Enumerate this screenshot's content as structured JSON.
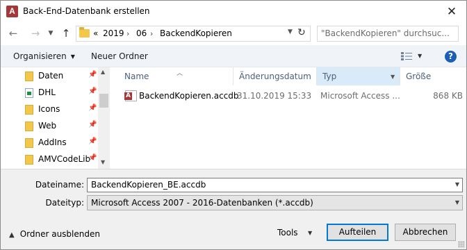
{
  "window": {
    "title": "Back-End-Datenbank erstellen",
    "app_icon_letter": "A",
    "close_glyph": "✕"
  },
  "navigation": {
    "back_glyph": "←",
    "forward_glyph": "→",
    "dropdown_glyph": "⌄",
    "up_glyph": "↑",
    "breadcrumb_overflow": "«",
    "breadcrumb": [
      "2019",
      "06",
      "BackendKopieren"
    ],
    "separator": "›",
    "refresh_glyph": "↻",
    "search_placeholder": "\"BackendKopieren\" durchsuc..."
  },
  "toolbar": {
    "organize_label": "Organisieren",
    "new_folder_label": "Neuer Ordner",
    "help_glyph": "?"
  },
  "sidebar": {
    "items": [
      {
        "label": "Daten",
        "icon": "folder-icon"
      },
      {
        "label": "DHL",
        "icon": "document-icon"
      },
      {
        "label": "Icons",
        "icon": "folder-icon"
      },
      {
        "label": "Web",
        "icon": "folder-icon"
      },
      {
        "label": "AddIns",
        "icon": "folder-icon"
      },
      {
        "label": "AMVCodeLib",
        "icon": "folder-icon"
      }
    ],
    "pin_glyph": "📌"
  },
  "filelist": {
    "columns": {
      "name": "Name",
      "date": "Änderungsdatum",
      "type": "Typ",
      "size": "Größe"
    },
    "rows": [
      {
        "name": "BackendKopieren.accdb",
        "date": "31.10.2019 15:33",
        "type": "Microsoft Access ...",
        "size": "868 KB",
        "icon": "access-file-icon"
      }
    ]
  },
  "form": {
    "filename_label": "Dateiname:",
    "filename_value": "BackendKopieren_BE.accdb",
    "filetype_label": "Dateityp:",
    "filetype_value": "Microsoft Access 2007 - 2016-Datenbanken (*.accdb)"
  },
  "footer": {
    "hide_folders_label": "Ordner ausblenden",
    "tools_label": "Tools",
    "save_label": "Aufteilen",
    "cancel_label": "Abbrechen"
  },
  "colors": {
    "access_red": "#a4373a",
    "selection_blue": "#0078d7",
    "column_highlight": "#d9ebf9",
    "folder_yellow": "#f2c84b"
  }
}
